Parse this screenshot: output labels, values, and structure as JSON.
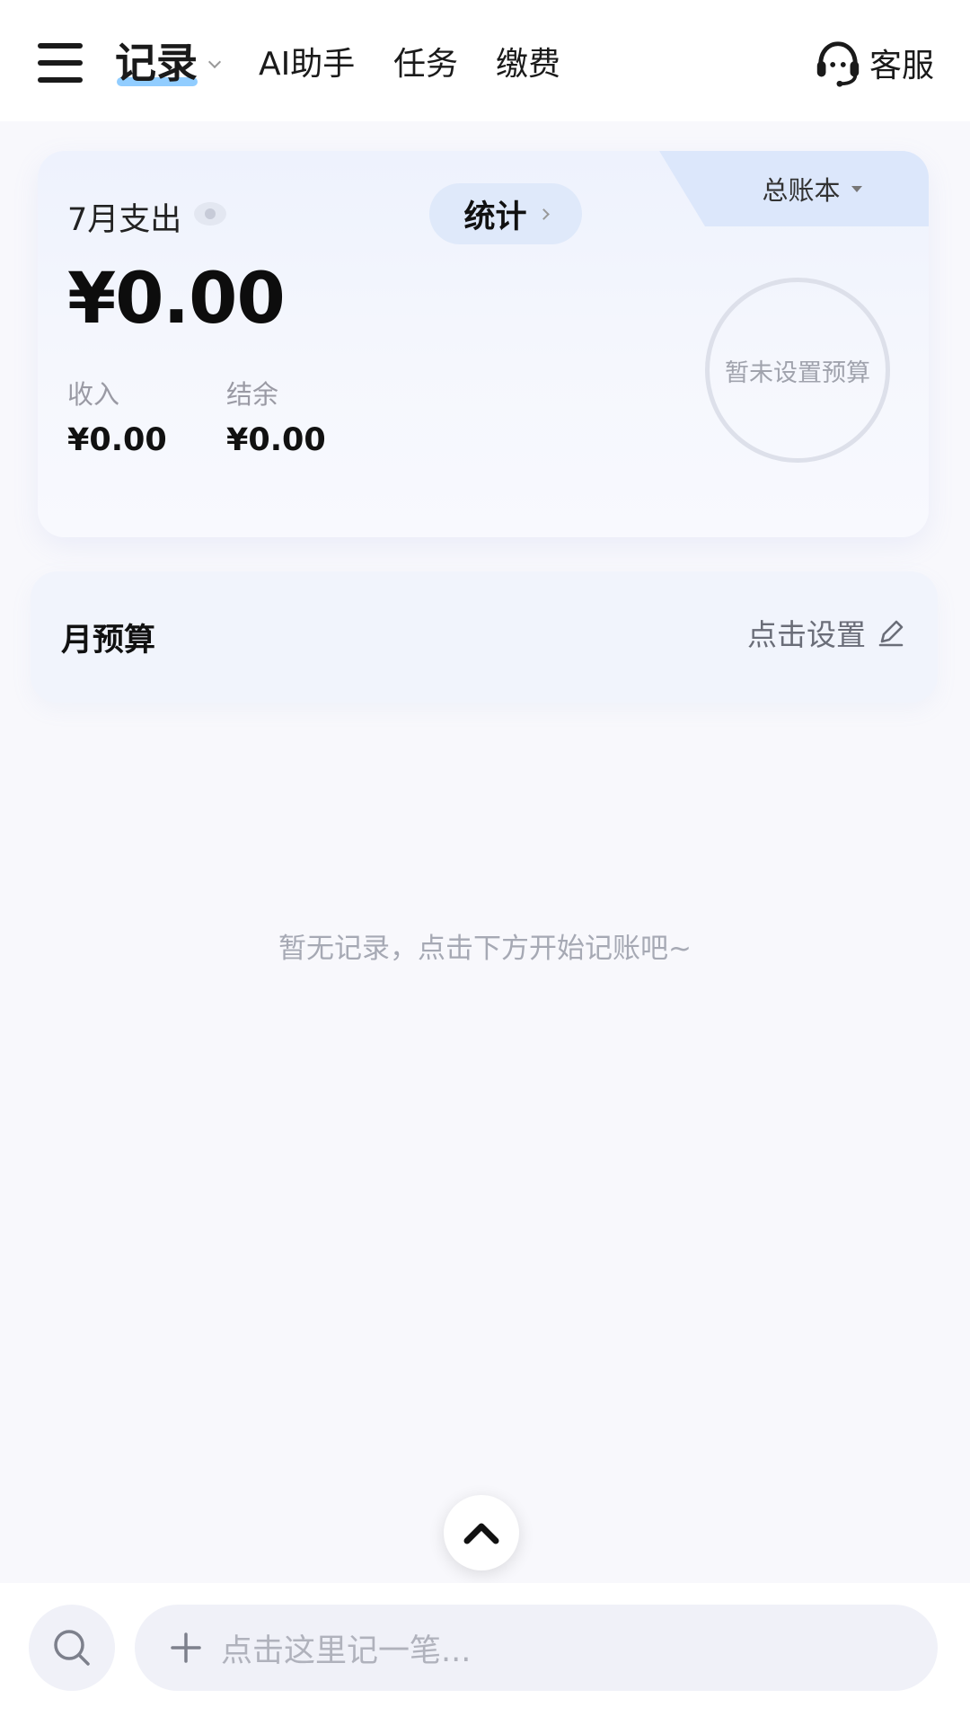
{
  "header": {
    "tabs": [
      {
        "label": "记录",
        "active": true
      },
      {
        "label": "AI助手"
      },
      {
        "label": "任务"
      },
      {
        "label": "缴费"
      }
    ],
    "service_label": "客服"
  },
  "summary": {
    "ledger_label": "总账本",
    "month_label": "7月支出",
    "stats_label": "统计",
    "expense_amount": "¥0.00",
    "income_label": "收入",
    "income_value": "¥0.00",
    "balance_label": "结余",
    "balance_value": "¥0.00",
    "budget_ring_text": "暂未设置预算"
  },
  "budget": {
    "title": "月预算",
    "set_label": "点击设置"
  },
  "empty_text": "暂无记录，点击下方开始记账吧~",
  "bottom": {
    "record_placeholder": "点击这里记一笔..."
  },
  "colors": {
    "accent_underline": "#7ec4ff",
    "card_bg": "#eef2fd",
    "ledger_tab_bg": "#dce7fb",
    "stats_btn_bg": "#dfe9fa"
  },
  "icons": [
    "menu-icon",
    "chevron-down-icon",
    "headset-icon",
    "eye-icon",
    "chevron-right-icon",
    "caret-down-icon",
    "pencil-icon",
    "chevron-up-icon",
    "search-icon",
    "plus-icon"
  ]
}
